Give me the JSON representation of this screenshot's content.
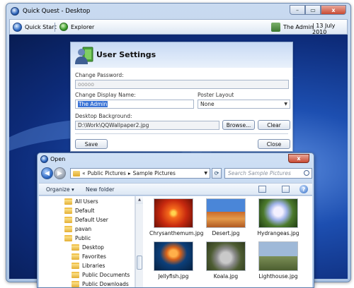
{
  "window": {
    "title": "Quick Quest - Desktop",
    "min": "–",
    "max": "▭",
    "close": "x"
  },
  "toolbar": {
    "quick_start": "Quick Start",
    "explorer": "Explorer",
    "user": "The Admin",
    "date": "| 13 July 2010"
  },
  "settings": {
    "title": "User Settings",
    "change_password_label": "Change Password:",
    "password_value": "ooooo",
    "display_name_label": "Change Display Name:",
    "display_name_value": "The Admin",
    "poster_layout_label": "Poster Layout",
    "poster_layout_value": "None",
    "background_label": "Desktop Background:",
    "background_value": "D:\\Work\\QQWallpaper2.jpg",
    "browse": "Browse...",
    "clear": "Clear",
    "save": "Save",
    "close": "Close"
  },
  "dialog": {
    "title": "Open",
    "close": "x",
    "address_sep": "«",
    "address_part1": "Public Pictures",
    "address_arrow": "▸",
    "address_part2": "Sample Pictures",
    "search_placeholder": "Search Sample Pictures",
    "organize": "Organize ▾",
    "new_folder": "New folder",
    "help": "?",
    "tree": [
      "All Users",
      "Default",
      "Default User",
      "pavan",
      "Public",
      "Desktop",
      "Favorites",
      "Libraries",
      "Public Documents",
      "Public Downloads"
    ],
    "files": [
      "Chrysanthemum.jpg",
      "Desert.jpg",
      "Hydrangeas.jpg",
      "Jellyfish.jpg",
      "Koala.jpg",
      "Lighthouse.jpg"
    ]
  }
}
